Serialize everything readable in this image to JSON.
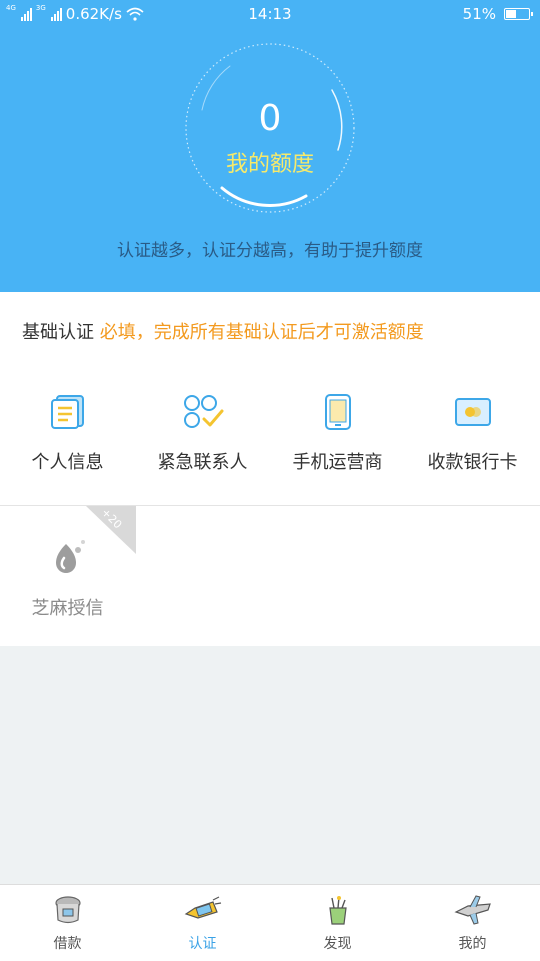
{
  "status_bar": {
    "net1": "4G",
    "net2": "3G",
    "speed": "0.62K/s",
    "time": "14:13",
    "battery_text": "51%",
    "battery_level": 0.51
  },
  "header": {
    "quota_value": "0",
    "quota_label": "我的额度",
    "hint": "认证越多，认证分越高，有助于提升额度"
  },
  "basic": {
    "title": "基础认证",
    "required_note": "必填，完成所有基础认证后才可激活额度",
    "items": [
      {
        "label": "个人信息",
        "icon": "personal-info-icon"
      },
      {
        "label": "紧急联系人",
        "icon": "emergency-contact-icon"
      },
      {
        "label": "手机运营商",
        "icon": "mobile-carrier-icon"
      },
      {
        "label": "收款银行卡",
        "icon": "bank-card-icon"
      }
    ]
  },
  "extra": {
    "zhima_label": "芝麻授信",
    "zhima_badge": "+20",
    "zhima_icon": "sesame-credit-icon"
  },
  "tabs": [
    {
      "label": "借款",
      "icon": "loan-icon",
      "active": false
    },
    {
      "label": "认证",
      "icon": "verify-icon",
      "active": true
    },
    {
      "label": "发现",
      "icon": "discover-icon",
      "active": false
    },
    {
      "label": "我的",
      "icon": "mine-icon",
      "active": false
    }
  ],
  "colors": {
    "header_bg": "#48b3f5",
    "accent_orange": "#f39a1f",
    "quota_yellow": "#f7ea6a",
    "active_tab": "#3aa2e6"
  }
}
